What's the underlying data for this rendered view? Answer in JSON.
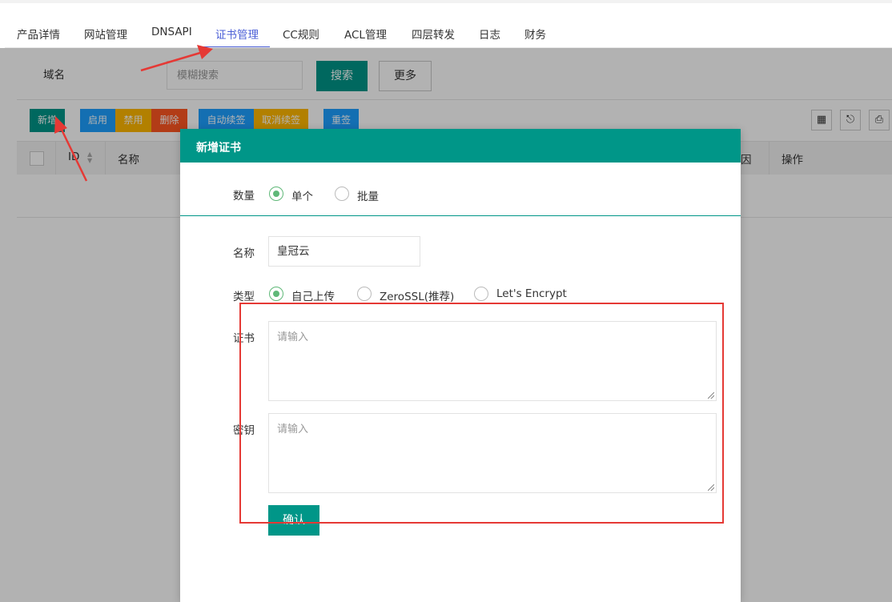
{
  "tabs": [
    {
      "label": "产品详情",
      "active": false
    },
    {
      "label": "网站管理",
      "active": false
    },
    {
      "label": "DNSAPI",
      "active": false
    },
    {
      "label": "证书管理",
      "active": true
    },
    {
      "label": "CC规则",
      "active": false
    },
    {
      "label": "ACL管理",
      "active": false
    },
    {
      "label": "四层转发",
      "active": false
    },
    {
      "label": "日志",
      "active": false
    },
    {
      "label": "财务",
      "active": false
    }
  ],
  "search": {
    "domain_label": "域名",
    "placeholder": "模糊搜索",
    "search_button": "搜索",
    "more_button": "更多"
  },
  "toolbar": {
    "buttons": [
      {
        "label": "新增",
        "color": "#009688"
      },
      {
        "label": "启用",
        "color": "#1e9fff"
      },
      {
        "label": "禁用",
        "color": "#ffb800"
      },
      {
        "label": "删除",
        "color": "#ff5722"
      },
      {
        "label": "自动续签",
        "color": "#1e9fff"
      },
      {
        "label": "取消续签",
        "color": "#ffb800"
      },
      {
        "label": "重签",
        "color": "#1e9fff"
      }
    ],
    "icons": [
      "columns-icon",
      "export-icon",
      "print-icon"
    ]
  },
  "table": {
    "columns": [
      "ID",
      "名称",
      "因",
      "操作"
    ]
  },
  "modal": {
    "title": "新增证书",
    "quantity_label": "数量",
    "quantity_options": [
      "单个",
      "批量"
    ],
    "name_label": "名称",
    "name_value": "皇冠云",
    "type_label": "类型",
    "type_options": [
      "自己上传",
      "ZeroSSL(推荐)",
      "Let's Encrypt"
    ],
    "cert_label": "证书",
    "cert_placeholder": "请输入",
    "key_label": "密钥",
    "key_placeholder": "请输入",
    "confirm_button": "确认"
  },
  "colors": {
    "primary": "#009688",
    "tab_active": "#4a5ed6",
    "radio_checked": "#5fb878",
    "annotation": "#e53935"
  }
}
